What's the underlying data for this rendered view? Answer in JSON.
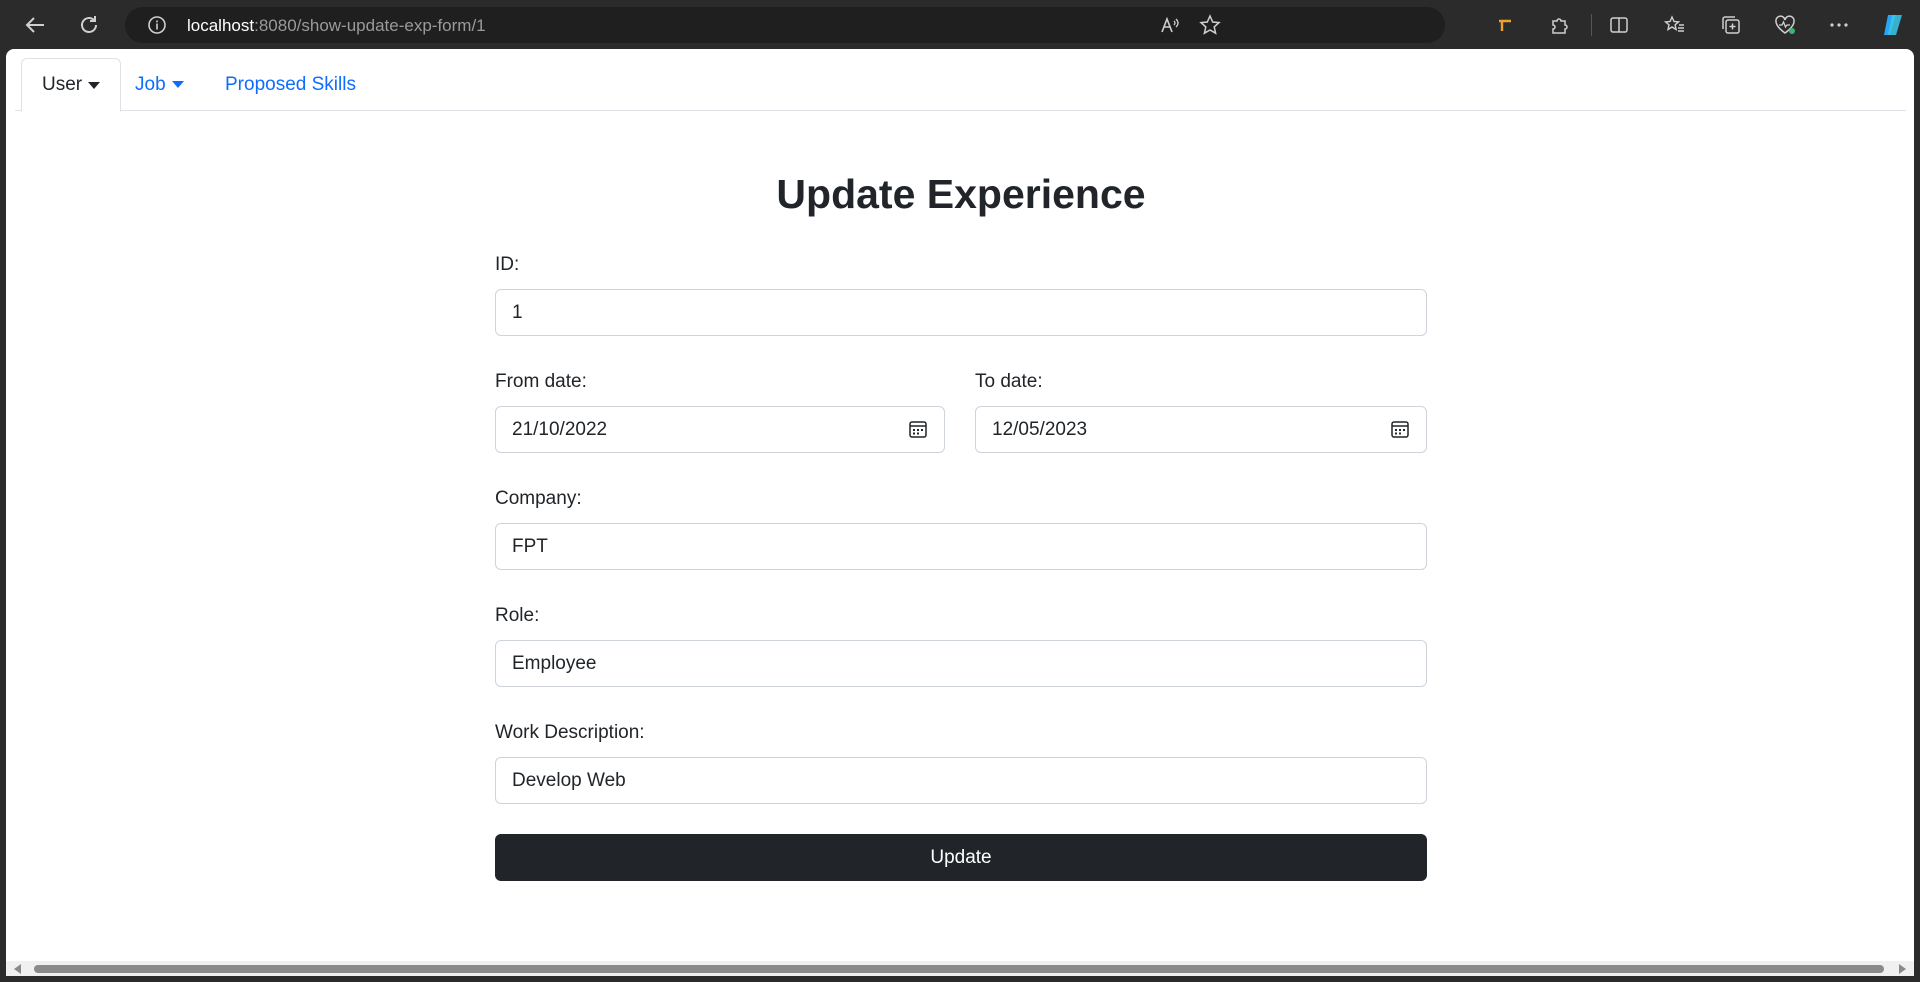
{
  "browser": {
    "url_host": "localhost",
    "url_rest": ":8080/show-update-exp-form/1"
  },
  "nav": {
    "tabs": [
      {
        "label": "User",
        "active": true,
        "dropdown": true
      },
      {
        "label": "Job",
        "active": false,
        "dropdown": true
      },
      {
        "label": "Proposed Skills",
        "active": false,
        "dropdown": false
      }
    ]
  },
  "form": {
    "title": "Update Experience",
    "id_label": "ID:",
    "id_value": "1",
    "from_label": "From date:",
    "from_value": "21/10/2022",
    "to_label": "To date:",
    "to_value": "12/05/2023",
    "company_label": "Company:",
    "company_value": "FPT",
    "role_label": "Role:",
    "role_value": "Employee",
    "desc_label": "Work Description:",
    "desc_value": "Develop Web",
    "submit_label": "Update"
  },
  "colors": {
    "link": "#0d6efd",
    "button_bg": "#212529",
    "chrome_bg": "#2b2b2b"
  }
}
